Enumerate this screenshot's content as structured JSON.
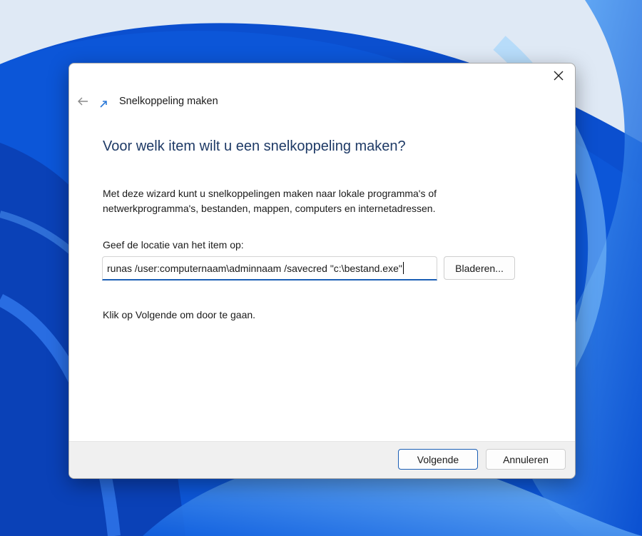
{
  "window": {
    "title": "Snelkoppeling maken",
    "heading": "Voor welk item wilt u een snelkoppeling maken?",
    "description": "Met deze wizard kunt u snelkoppelingen maken naar lokale programma's of netwerkprogramma's, bestanden, mappen, computers en internetadressen.",
    "location_label": "Geef de locatie van het item op:",
    "location_value": "runas /user:computernaam\\adminnaam /savecred \"c:\\bestand.exe\"",
    "browse_label": "Bladeren...",
    "hint": "Klik op Volgende om door te gaan.",
    "icons": {
      "back": "back-arrow-icon",
      "close": "close-icon",
      "wizard": "shortcut-icon"
    }
  },
  "footer": {
    "next_label": "Volgende",
    "cancel_label": "Annuleren"
  },
  "colors": {
    "heading": "#1e3a66",
    "accent": "#1b5fb5",
    "footer_bg": "#f0f0f0"
  }
}
